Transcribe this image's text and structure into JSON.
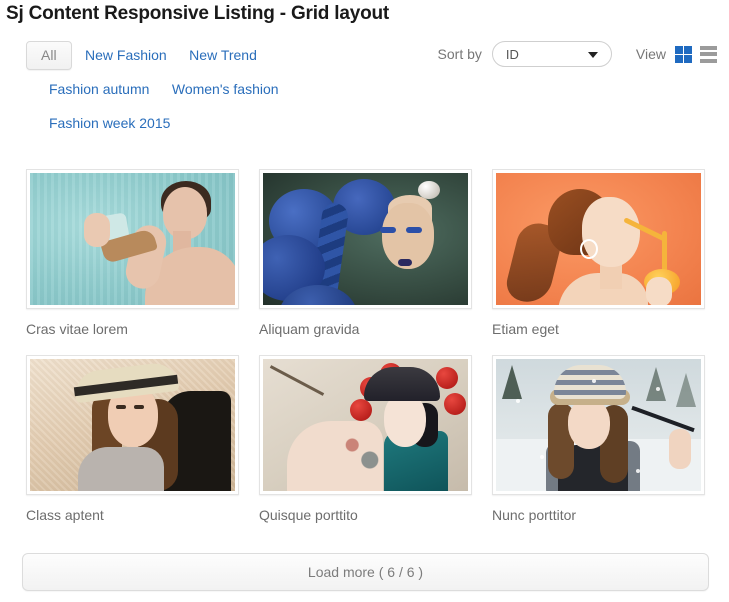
{
  "header": {
    "title": "Sj Content Responsive Listing - Grid layout"
  },
  "filters": {
    "items": [
      {
        "label": "All",
        "active": true
      },
      {
        "label": "New Fashion",
        "active": false
      },
      {
        "label": "New Trend",
        "active": false
      },
      {
        "label": "Fashion autumn",
        "active": false
      },
      {
        "label": "Women's fashion",
        "active": false
      },
      {
        "label": "Fashion week 2015",
        "active": false
      }
    ]
  },
  "toolbar": {
    "sort_label": "Sort by",
    "sort_value": "ID",
    "sort_options": [
      "ID"
    ],
    "view_label": "View",
    "grid_icon": "grid-view-icon",
    "list_icon": "list-view-icon",
    "active_view": "grid",
    "accent_color": "#1f6ac0",
    "inactive_color": "#9b9b9b",
    "link_color": "#2a6ebb"
  },
  "items": [
    {
      "title": "Cras vitae lorem",
      "image_alt": "woman-holding-shoe-teal-background"
    },
    {
      "title": "Aliquam gravida",
      "image_alt": "model-blue-hair-blue-makeup"
    },
    {
      "title": "Etiam eget",
      "image_alt": "redhead-drinking-orange-juice"
    },
    {
      "title": "Class aptent",
      "image_alt": "woman-with-hat-sepia-portrait"
    },
    {
      "title": "Quisque porttito",
      "image_alt": "woman-red-pompom-headdress"
    },
    {
      "title": "Nunc porttitor",
      "image_alt": "girl-knit-hat-winter-snow"
    }
  ],
  "footer": {
    "load_more_label": "Load more ( 6 / 6 )"
  }
}
